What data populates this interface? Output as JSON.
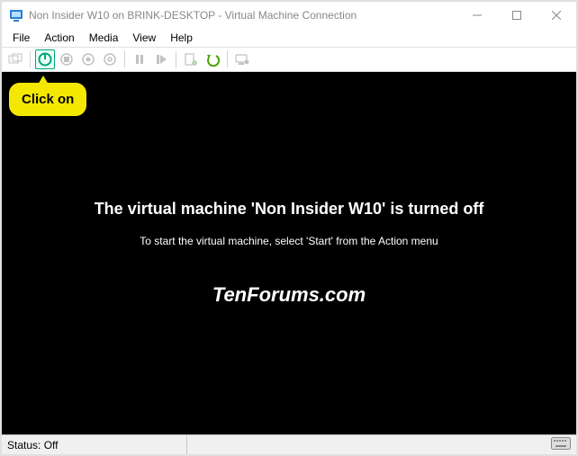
{
  "titlebar": {
    "title": "Non Insider W10 on BRINK-DESKTOP - Virtual Machine Connection"
  },
  "menu": {
    "items": [
      "File",
      "Action",
      "Media",
      "View",
      "Help"
    ]
  },
  "toolbar": {
    "icons": {
      "ctrl_alt_del": "ctrl-alt-del-icon",
      "start": "start-icon",
      "turnoff": "turn-off-icon",
      "shutdown": "shutdown-icon",
      "save": "save-icon",
      "pause": "pause-icon",
      "reset": "reset-icon",
      "checkpoint": "checkpoint-icon",
      "revert": "revert-icon",
      "enhanced": "enhanced-session-icon"
    },
    "colors": {
      "accent": "#00a67a",
      "revert": "#4aa000"
    }
  },
  "content": {
    "heading": "The virtual machine 'Non Insider W10' is turned off",
    "subtext": "To start the virtual machine, select 'Start' from the Action menu",
    "watermark": "TenForums.com"
  },
  "callout": {
    "text": "Click on"
  },
  "statusbar": {
    "status": "Status: Off"
  }
}
